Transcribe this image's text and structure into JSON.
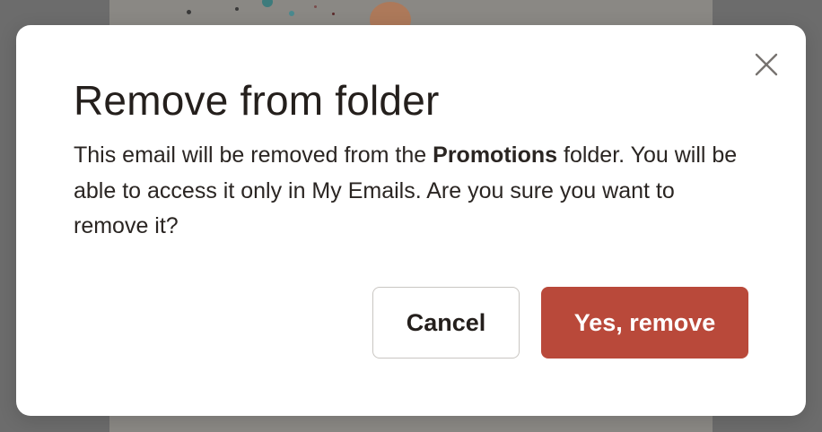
{
  "dialog": {
    "title": "Remove from folder",
    "message_before": "This email will be removed from the ",
    "folder_name": "Promotions",
    "message_after": " folder. You will be able to access it only in My Emails. Are you sure you want to remove it?",
    "close_icon": "close-icon",
    "cancel_label": "Cancel",
    "confirm_label": "Yes, remove"
  },
  "colors": {
    "confirm_button": "#b9493a",
    "title_text": "#241f1c",
    "overlay": "#767676",
    "modal_background": "#ffffff"
  }
}
